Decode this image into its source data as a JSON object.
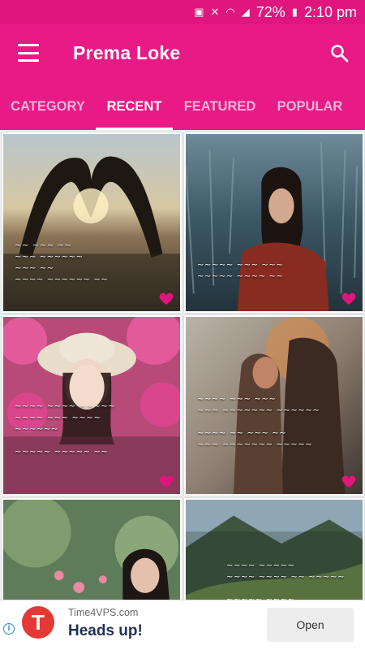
{
  "status_bar": {
    "battery": "72%",
    "time": "2:10 pm"
  },
  "app_bar": {
    "title": "Prema Loke"
  },
  "tabs": [
    {
      "label": "CATEGORY",
      "active": false
    },
    {
      "label": "RECENT",
      "active": true
    },
    {
      "label": "FEATURED",
      "active": false
    },
    {
      "label": "POPULAR",
      "active": false
    }
  ],
  "ad": {
    "sponsor": "Time4VPS.com",
    "headline": "Heads up!",
    "button": "Open",
    "logo_letter": "T",
    "info_icon": "i"
  },
  "colors": {
    "primary": "#e81a85",
    "status_bar": "#e0167f"
  }
}
